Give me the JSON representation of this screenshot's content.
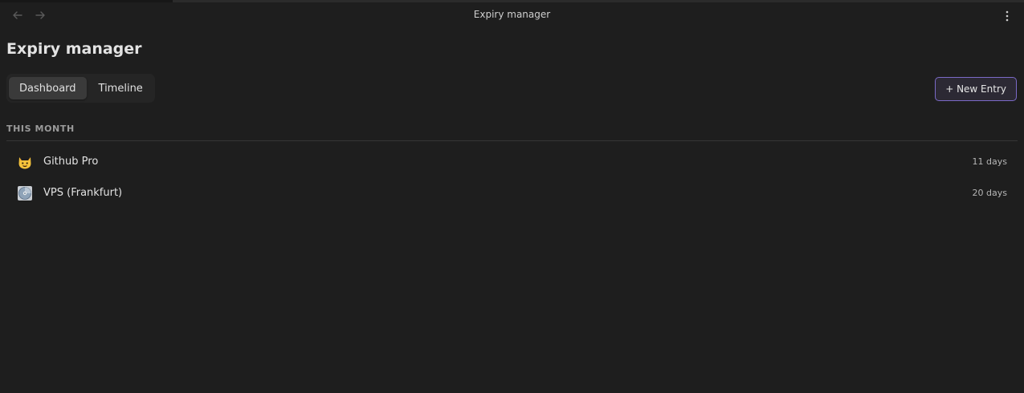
{
  "window": {
    "title": "Expiry manager"
  },
  "icons": {
    "back": "arrow-left-icon",
    "forward": "arrow-right-icon",
    "more": "more-vertical-icon"
  },
  "page": {
    "title": "Expiry manager"
  },
  "tabs": [
    {
      "label": "Dashboard",
      "active": true
    },
    {
      "label": "Timeline",
      "active": false
    }
  ],
  "actions": {
    "new_entry_label": "+ New Entry"
  },
  "section": {
    "label": "THIS MONTH"
  },
  "items": [
    {
      "icon": "cat-face-icon",
      "name": "Github Pro",
      "remaining": "11 days"
    },
    {
      "icon": "disc-icon",
      "name": "VPS (Frankfurt)",
      "remaining": "20 days"
    }
  ],
  "colors": {
    "background": "#1e1e1e",
    "accent_border": "#7b6ac7",
    "cat_yellow": "#f5c33b"
  }
}
